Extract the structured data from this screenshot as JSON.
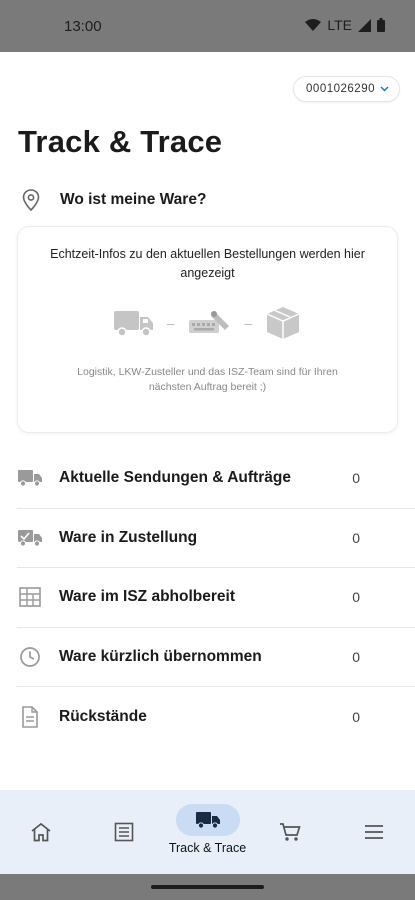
{
  "status_bar": {
    "time": "13:00",
    "network": "LTE"
  },
  "account": {
    "number": "0001026290"
  },
  "page_title": "Track & Trace",
  "where_heading": "Wo ist meine Ware?",
  "info_card": {
    "headline": "Echtzeit-Infos zu den aktuellen Bestellungen werden hier angezeigt",
    "subtext": "Logistik, LKW-Zusteller und das ISZ-Team sind für Ihren nächsten Auftrag bereit ;)"
  },
  "status_list": [
    {
      "label": "Aktuelle Sendungen & Aufträge",
      "count": "0",
      "icon": "truck-icon"
    },
    {
      "label": "Ware in Zustellung",
      "count": "0",
      "icon": "delivery-truck-icon"
    },
    {
      "label": "Ware im ISZ abholbereit",
      "count": "0",
      "icon": "warehouse-icon"
    },
    {
      "label": "Ware kürzlich übernommen",
      "count": "0",
      "icon": "clock-icon"
    },
    {
      "label": "Rückstände",
      "count": "0",
      "icon": "document-icon"
    }
  ],
  "bottom_nav": {
    "items": [
      {
        "icon": "home-icon"
      },
      {
        "icon": "list-icon"
      },
      {
        "icon": "truck-icon",
        "label": "Track & Trace",
        "active": true
      },
      {
        "icon": "cart-icon"
      },
      {
        "icon": "menu-icon"
      }
    ]
  },
  "colors": {
    "accent": "#2a6fc9",
    "nav_bg": "#e9eff8",
    "nav_active": "#c9dcf3"
  }
}
